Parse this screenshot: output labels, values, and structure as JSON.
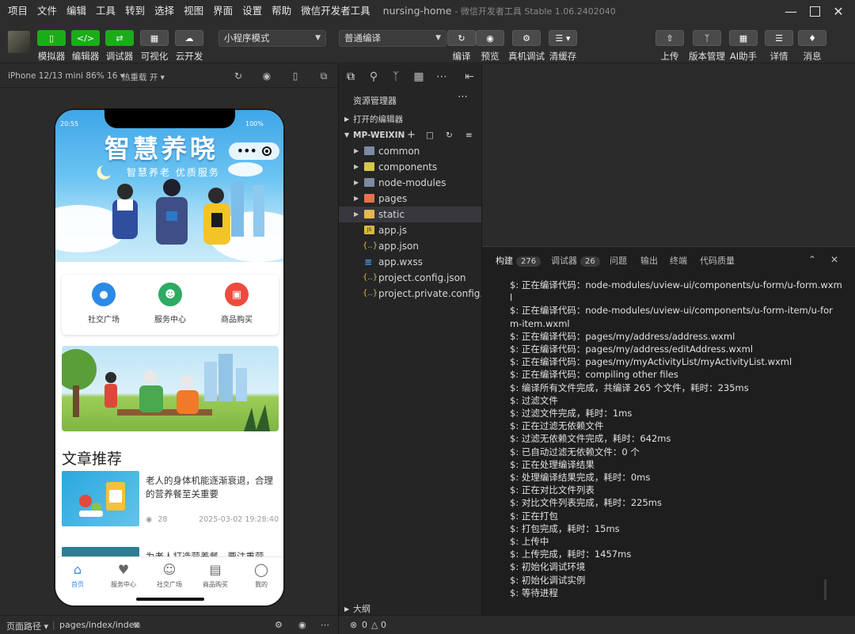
{
  "menubar": {
    "items": [
      "项目",
      "文件",
      "编辑",
      "工具",
      "转到",
      "选择",
      "视图",
      "界面",
      "设置",
      "帮助",
      "微信开发者工具"
    ],
    "project": "nursing-home",
    "app_title": "- 微信开发者工具 Stable 1.06.2402040"
  },
  "toolbar": {
    "left_buttons": [
      "模拟器",
      "编辑器",
      "调试器",
      "可视化",
      "云开发"
    ],
    "mode_select": "小程序模式",
    "compile_select": "普通编译",
    "mid_buttons": [
      "编译",
      "预览",
      "真机调试",
      "清缓存"
    ],
    "right_buttons": [
      "上传",
      "版本管理",
      "AI助手",
      "详情",
      "消息"
    ]
  },
  "simulator": {
    "device": "iPhone 12/13 mini 86% 16",
    "hot_reload": "热重载 开",
    "status_time": "20:55",
    "status_battery": "100%",
    "hero_title": "智慧养晓",
    "hero_subtitle": "智慧养老 优质服务",
    "services": [
      {
        "label": "社交广场",
        "color": "#2b8ae6"
      },
      {
        "label": "服务中心",
        "color": "#2eaa62"
      },
      {
        "label": "商品购买",
        "color": "#ee4b3e"
      }
    ],
    "section_title": "文章推荐",
    "articles": [
      {
        "title": "老人的身体机能逐渐衰退，合理的营养餐至关重要",
        "views": "28",
        "date": "2025-03-02 19:28:40"
      },
      {
        "title": "为老人打造营养餐，要注重营",
        "views": "",
        "date": ""
      }
    ],
    "tabs": [
      "首页",
      "服务中心",
      "社交广场",
      "商品购买",
      "我的"
    ],
    "footer_path_label": "页面路径",
    "footer_path": "pages/index/index"
  },
  "explorer": {
    "title": "资源管理器",
    "open_editors": "打开的编辑器",
    "project_root": "MP-WEIXIN",
    "folders": [
      {
        "name": "common",
        "color": "#7b8ba3"
      },
      {
        "name": "components",
        "color": "#d7c74a"
      },
      {
        "name": "node-modules",
        "color": "#7b8ba3"
      },
      {
        "name": "pages",
        "color": "#e8704a"
      },
      {
        "name": "static",
        "color": "#e8b84a"
      }
    ],
    "files": [
      {
        "name": "app.js",
        "icon": "JS",
        "color": "#d7b842"
      },
      {
        "name": "app.json",
        "icon": "{}",
        "color": "#d7b842"
      },
      {
        "name": "app.wxss",
        "icon": "CSS",
        "color": "#4a9de8"
      },
      {
        "name": "project.config.json",
        "icon": "{}",
        "color": "#d7b842"
      },
      {
        "name": "project.private.config.js...",
        "icon": "{}",
        "color": "#d7b842"
      }
    ],
    "outline": "大纲"
  },
  "panel": {
    "tabs": [
      {
        "label": "构建",
        "badge": "276"
      },
      {
        "label": "调试器",
        "badge": "26"
      },
      {
        "label": "问题",
        "badge": ""
      },
      {
        "label": "输出",
        "badge": ""
      },
      {
        "label": "终端",
        "badge": ""
      },
      {
        "label": "代码质量",
        "badge": ""
      }
    ],
    "log": [
      "$: 正在编译代码：node-modules/uview-ui/components/u-form/u-form.wxm",
      "l",
      "$: 正在编译代码：node-modules/uview-ui/components/u-form-item/u-for",
      "m-item.wxml",
      "$: 正在编译代码：pages/my/address/address.wxml",
      "$: 正在编译代码：pages/my/address/editAddress.wxml",
      "$: 正在编译代码：pages/my/myActivityList/myActivityList.wxml",
      "$: 正在编译代码：compiling other files",
      "$: 编译所有文件完成，共编译 265 个文件，耗时：235ms",
      "$: 过滤文件",
      "$: 过滤文件完成，耗时：1ms",
      "$: 正在过滤无依赖文件",
      "$: 过滤无依赖文件完成，耗时：642ms",
      "$: 已自动过滤无依赖文件：0 个",
      "$: 正在处理编译结果",
      "$: 处理编译结果完成，耗时：0ms",
      "$: 正在对比文件列表",
      "$: 对比文件列表完成，耗时：225ms",
      "$: 正在打包",
      "$: 打包完成，耗时：15ms",
      "$: 上传中",
      "$: 上传完成，耗时：1457ms",
      "$: 初始化调试环境",
      "$: 初始化调试实例",
      "$: 等待进程"
    ]
  },
  "statusbar": {
    "errors": "0",
    "warnings": "0"
  }
}
